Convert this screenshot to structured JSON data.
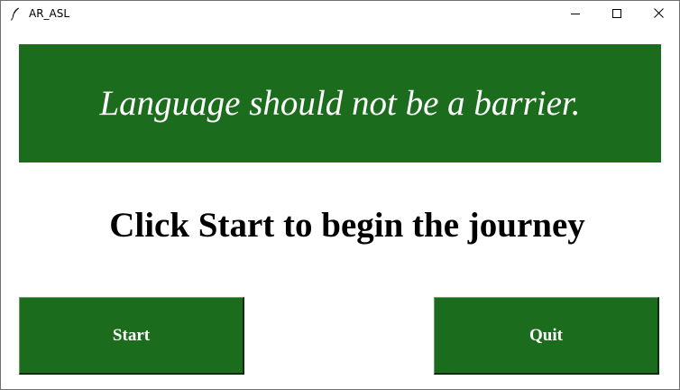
{
  "window": {
    "title": "AR_ASL",
    "icon": "feather-icon",
    "controls": [
      "minimize-icon",
      "maximize-icon",
      "close-icon"
    ]
  },
  "banner": {
    "text": "Language should not be a barrier."
  },
  "headline": {
    "text": "Click Start to begin the journey"
  },
  "buttons": {
    "start_label": "Start",
    "quit_label": "Quit"
  },
  "colors": {
    "accent": "#1b6d1d",
    "banner_text": "#ffffff",
    "headline_text": "#000000"
  }
}
